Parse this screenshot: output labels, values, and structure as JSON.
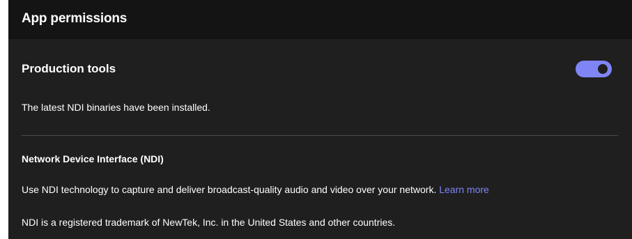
{
  "header": {
    "title": "App permissions"
  },
  "production_tools": {
    "title": "Production tools",
    "toggle_on": true,
    "status_text": "The latest NDI binaries have been installed."
  },
  "ndi": {
    "title": "Network Device Interface (NDI)",
    "description": "Use NDI technology to capture and deliver broadcast-quality audio and video over your network.",
    "learn_more_label": "Learn more",
    "trademark_text": "NDI is a registered trademark of NewTek, Inc. in the United States and other countries."
  },
  "colors": {
    "background": "#1f1f1f",
    "header_background": "#141414",
    "accent": "#7f85f5",
    "divider": "#4a4a4a",
    "text": "#ffffff"
  }
}
